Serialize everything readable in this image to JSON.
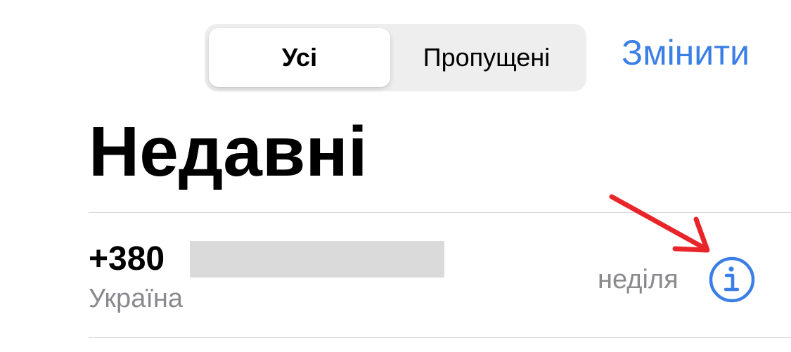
{
  "segments": {
    "all_label": "Усі",
    "missed_label": "Пропущені",
    "selected": "all"
  },
  "header": {
    "edit_label": "Змінити",
    "title": "Недавні"
  },
  "calls": [
    {
      "number_prefix": "+380",
      "number_redacted": true,
      "location": "Україна",
      "day": "неділя",
      "info_icon": "info-icon"
    }
  ],
  "annotation": {
    "arrow_color": "#e8262a"
  },
  "colors": {
    "accent": "#3b7fe6",
    "secondary_text": "#8a8a8e",
    "segment_bg": "#eeeeef"
  }
}
